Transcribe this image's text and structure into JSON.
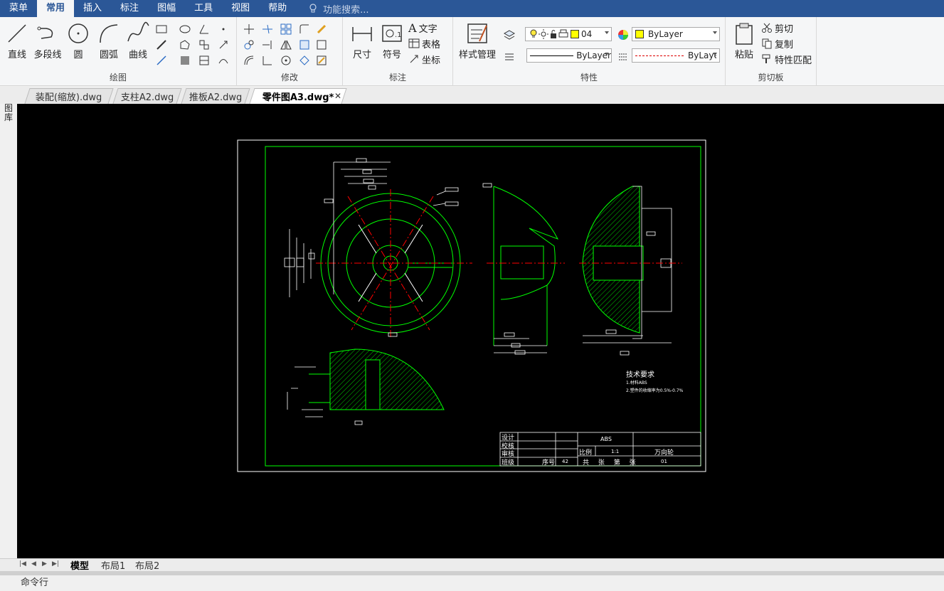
{
  "menu": {
    "items": [
      "菜单",
      "常用",
      "插入",
      "标注",
      "图幅",
      "工具",
      "视图",
      "帮助"
    ],
    "active_index": 1,
    "search_placeholder": "功能搜索..."
  },
  "ribbon": {
    "draw": {
      "title": "绘图",
      "line": "直线",
      "polyline": "多段线",
      "circle": "圆",
      "arc": "圆弧",
      "curve": "曲线"
    },
    "modify": {
      "title": "修改"
    },
    "annotate": {
      "title": "标注",
      "dimension": "尺寸",
      "symbol": "符号",
      "text": "文字",
      "table": "表格",
      "coord": "坐标"
    },
    "properties": {
      "title": "特性",
      "style_manager": "样式管理",
      "layer_value": "04",
      "color_value": "ByLayer",
      "linetype_value": "ByLayer",
      "lineweight_value": "ByLaye"
    },
    "clipboard": {
      "title": "剪切板",
      "paste": "粘贴",
      "cut": "剪切",
      "copy": "复制",
      "match": "特性匹配"
    }
  },
  "doc_tabs": [
    {
      "label": "装配(缩放).dwg",
      "active": false
    },
    {
      "label": "支柱A2.dwg",
      "active": false
    },
    {
      "label": "推板A2.dwg",
      "active": false
    },
    {
      "label": "零件图A3.dwg*",
      "active": true
    }
  ],
  "left_strip_label": "图库",
  "drawing": {
    "tech_title": "技术要求",
    "tech_line1": "1.材料ABS",
    "tech_line2": "2.塑件的收缩率为0.5%-0.7%",
    "title_block": {
      "design": "设计",
      "check": "校核",
      "review": "审核",
      "class": "班级",
      "seq_label": "序号",
      "seq_value": "42",
      "material": "ABS",
      "scale_label": "比例",
      "scale_value": "1:1",
      "part_name": "万向轮",
      "sheets": "共 张 第 张",
      "drawing_no": "01"
    }
  },
  "layout_tabs": [
    "模型",
    "布局1",
    "布局2"
  ],
  "command_label": "命令行",
  "colors": {
    "menubar": "#2b5797",
    "drawing_green": "#00ff00",
    "center_red": "#ff0000",
    "frame_white": "#ffffff"
  }
}
